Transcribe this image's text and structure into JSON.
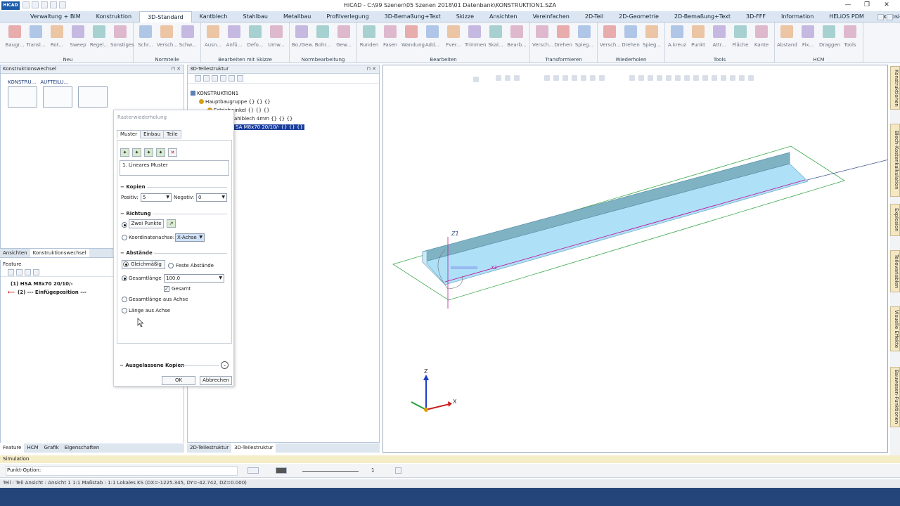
{
  "window": {
    "app_logo": "HiCAD",
    "title": "HiCAD - C:\\99 Szenen\\05 Szenen 2018\\01 Datenbank\\KONSTRUKTION1.SZA",
    "minimize": "—",
    "maximize": "❐",
    "close": "✕"
  },
  "ribbon_tabs": [
    "Verwaltung + BIM",
    "Konstruktion",
    "3D-Standard",
    "Kantblech",
    "Stahlbau",
    "Metallbau",
    "Profilverlegung",
    "3D-Bemaßung+Text",
    "Skizze",
    "Ansichten",
    "Vereinfachen",
    "2D-Teil",
    "2D-Geometrie",
    "2D-Bemaßung+Text",
    "3D-FFF",
    "Information",
    "HELiOS PDM",
    "Explosion"
  ],
  "ribbon_active": "3D-Standard",
  "ribbon_groups": [
    {
      "label": "Neu",
      "buttons": [
        "Baugr...",
        "Transl...",
        "Rot...",
        "Sweep",
        "Regel...",
        "Sonstiges"
      ]
    },
    {
      "label": "Normteile",
      "buttons": [
        "Schr...",
        "Versch...",
        "Schw..."
      ]
    },
    {
      "label": "Bearbeiten mit Skizze",
      "buttons": [
        "Ausn...",
        "Anfü...",
        "Defo...",
        "Umw..."
      ]
    },
    {
      "label": "Normbearbeitung",
      "buttons": [
        "Bo./Gew.",
        "Bohr...",
        "Gew..."
      ]
    },
    {
      "label": "Bearbeiten",
      "buttons": [
        "Runden",
        "Fasen",
        "Wandung",
        "Add...",
        "Fver...",
        "Trimmen",
        "Skal...",
        "Bearb..."
      ]
    },
    {
      "label": "Transformieren",
      "buttons": [
        "Versch...",
        "Drehen",
        "Spieg..."
      ]
    },
    {
      "label": "Wiederholen",
      "buttons": [
        "Versch...",
        "Drehen",
        "Spieg..."
      ]
    },
    {
      "label": "Tools",
      "buttons": [
        "A.kreuz",
        "Punkt",
        "Attr...",
        "Fläche",
        "Kante"
      ]
    },
    {
      "label": "HCM",
      "buttons": [
        "Abstand",
        "Fix...",
        "Draggen",
        "Tools"
      ]
    }
  ],
  "konstruktionswechsel": {
    "title": "Konstruktionswechsel",
    "tabs": [
      "KONSTRU...",
      "AUFTEILU..."
    ]
  },
  "left_lower_tabs": [
    "Ansichten",
    "Konstruktionswechsel"
  ],
  "feature": {
    "title": "Feature",
    "rows": [
      {
        "mark": "",
        "text": "(1)  HSA M8x70 20/10/-"
      },
      {
        "mark": "⟵",
        "text": "(2)  --- Einfügeposition ---"
      }
    ]
  },
  "left_bottom_tabs": [
    "Feature",
    "HCM",
    "Grafik",
    "Eigenschaften"
  ],
  "teilestruktur": {
    "title": "3D-Teilestruktur",
    "root": "KONSTRUKTION1",
    "items": [
      "Hauptbaugruppe {} {} {}",
      "Estrichwinkel {} {} {}",
      "ahlblech 4mm {} {} {}",
      "SA M8x70 20/10/- {} {} {}"
    ]
  },
  "ts_bottom_tabs": [
    "2D-Teilestruktur",
    "3D-Teilestruktur"
  ],
  "dialog": {
    "title": "Rasterwiederholung",
    "tabs": [
      "Muster",
      "Einbau",
      "Teile"
    ],
    "muster_item": "1. Lineares Muster",
    "kopien_title": "Kopien",
    "positiv_label": "Positiv:",
    "positiv_value": "5",
    "negativ_label": "Negativ:",
    "negativ_value": "0",
    "richtung_title": "Richtung",
    "zwei_punkte": "Zwei Punkte",
    "koordinatenachse": "Koordinatenachse:",
    "achse_value": "X-Achse",
    "abstaende_title": "Abstände",
    "gleichmaessig": "Gleichmäßig",
    "feste_abstaende": "Feste Abstände",
    "gesamtlaenge": "Gesamtlänge",
    "gesamtlaenge_value": "100.0",
    "gesamt": "Gesamt",
    "gesamtlaenge_achse": "Gesamtlänge aus Achse",
    "laenge_achse": "Länge aus Achse",
    "ausgelassene": "Ausgelassene Kopien",
    "ok": "OK",
    "abbrechen": "Abbrechen"
  },
  "viewport": {
    "z1_label": "Z1",
    "x1_label": "X1",
    "triad_z": "Z",
    "triad_x": "X"
  },
  "side_tabs": [
    "Konstruktionen",
    "Blech-Kostenkalkulation",
    "Explosion",
    "Teilevariablen",
    "Visuelle Effekte",
    "Bauwesen-Funktionen"
  ],
  "simulation_tab": "Simulation",
  "command_label": "Punkt-Option:",
  "line_width_value": "1",
  "status_text": "Teil : Teil    Ansicht : Ansicht 1 1:1    Maßstab : 1:1    Lokales KS  (DX=-1225.345, DY=-42.742, DZ=0.000)",
  "colors": {
    "accent": "#1a3e9c",
    "part_fill": "#aee0f7",
    "part_top": "#7fb3c4",
    "grid_green": "#3aa84a",
    "selection": "#1a3e9c"
  }
}
